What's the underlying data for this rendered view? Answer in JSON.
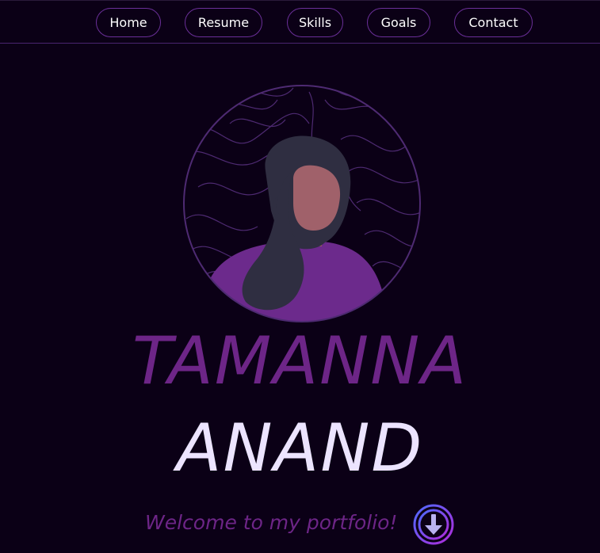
{
  "nav": {
    "items": [
      {
        "label": "Home"
      },
      {
        "label": "Resume"
      },
      {
        "label": "Skills"
      },
      {
        "label": "Goals"
      },
      {
        "label": "Contact"
      }
    ]
  },
  "hero": {
    "first_name": "TAMANNA",
    "last_name": "ANAND",
    "welcome_text": "Welcome to my portfolio!",
    "scroll_icon": "arrow-down-icon"
  },
  "colors": {
    "background": "#0b0016",
    "accent_purple": "#6d2587",
    "light_lavender": "#ece4ff",
    "nav_border": "#6a2f98",
    "avatar_skin": "#a0616a",
    "avatar_hair": "#2f2e41",
    "avatar_shirt": "#6c2a8c"
  }
}
